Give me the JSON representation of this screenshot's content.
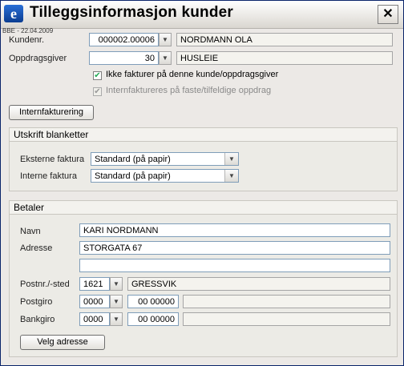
{
  "window": {
    "title": "Tilleggsinformasjon kunder",
    "app_icon_letter": "e",
    "close_glyph": "✕",
    "version": "BBE - 22.04.2009"
  },
  "kunde": {
    "label": "Kundenr.",
    "number": "000002.00006",
    "name": "NORDMANN OLA"
  },
  "oppdragsgiver": {
    "label": "Oppdragsgiver",
    "number": "30",
    "name": "HUSLEIE"
  },
  "checks": {
    "ikke_fakturer": {
      "label": "Ikke fakturer på denne kunde/oppdragsgiver",
      "checked": true
    },
    "internfaktureres": {
      "label": "Internfaktureres på faste/tilfeldige oppdrag",
      "checked": true
    }
  },
  "buttons": {
    "internfakturering": "Internfakturering",
    "velg_adresse": "Velg adresse"
  },
  "utskrift": {
    "title": "Utskrift blanketter",
    "eksterne_label": "Eksterne faktura",
    "eksterne_value": "Standard (på papir)",
    "interne_label": "Interne faktura",
    "interne_value": "Standard (på papir)"
  },
  "betaler": {
    "title": "Betaler",
    "navn_label": "Navn",
    "navn": "KARI NORDMANN",
    "adresse_label": "Adresse",
    "adresse1": "STORGATA 67",
    "adresse2": "",
    "postnr_label": "Postnr./-sted",
    "postnr": "1621",
    "poststed": "GRESSVIK",
    "postgiro_label": "Postgiro",
    "postgiro_a": "0000",
    "postgiro_b": "00 00000",
    "postgiro_c": "",
    "bankgiro_label": "Bankgiro",
    "bankgiro_a": "0000",
    "bankgiro_b": "00 00000",
    "bankgiro_c": ""
  },
  "icons": {
    "dropdown": "▼",
    "check": "✔"
  }
}
